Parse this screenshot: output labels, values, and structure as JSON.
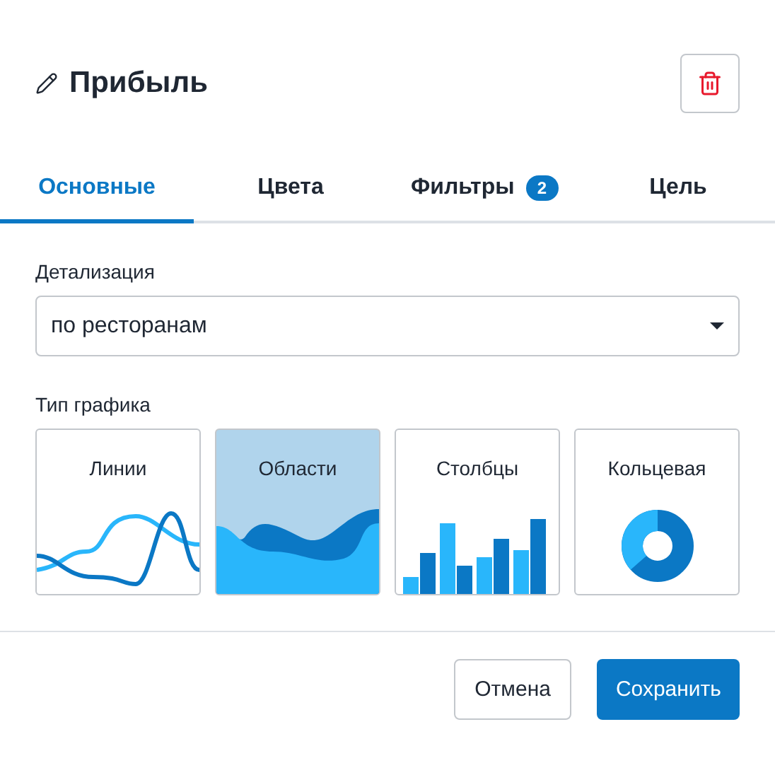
{
  "dialog": {
    "title": "Прибыль"
  },
  "tabs": [
    {
      "label": "Основные",
      "selected": true
    },
    {
      "label": "Цвета",
      "selected": false
    },
    {
      "label": "Фильтры",
      "badge": "2",
      "selected": false
    },
    {
      "label": "Цель",
      "selected": false
    }
  ],
  "detail": {
    "label": "Детализация",
    "value": "по ресторанам"
  },
  "chart_type": {
    "label": "Тип графика",
    "options": [
      {
        "label": "Линии",
        "kind": "lines",
        "selected": false
      },
      {
        "label": "Области",
        "kind": "areas",
        "selected": true
      },
      {
        "label": "Столбцы",
        "kind": "bars",
        "selected": false
      },
      {
        "label": "Кольцевая",
        "kind": "donut",
        "selected": false
      }
    ]
  },
  "buttons": {
    "cancel": "Отмена",
    "save": "Сохранить"
  }
}
